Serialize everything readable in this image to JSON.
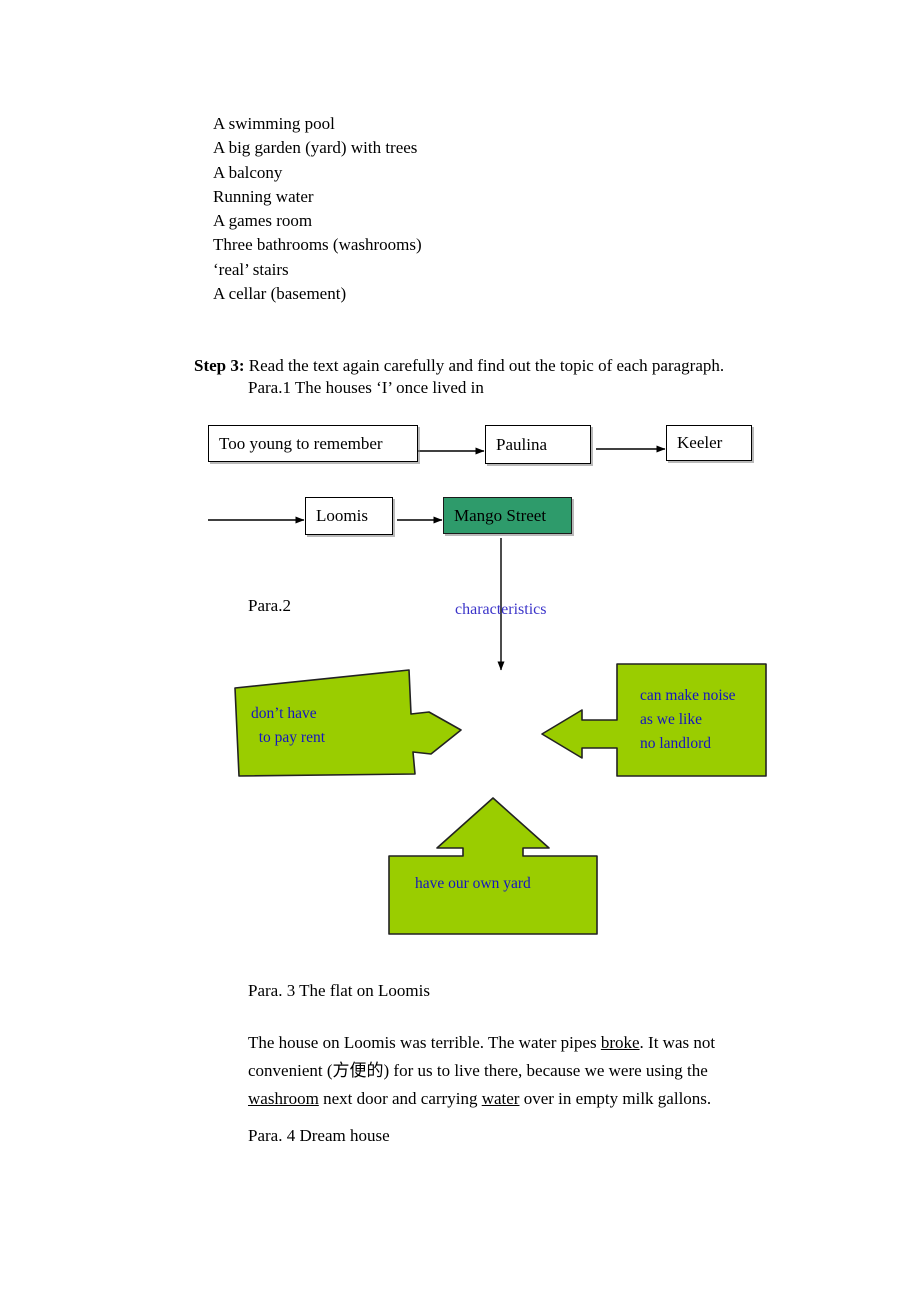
{
  "document": {
    "feature_list": [
      "A swimming pool",
      "A big garden (yard) with trees",
      "A balcony",
      "Running water",
      "A games room",
      "Three bathrooms (washrooms)",
      "‘real’ stairs",
      "A cellar (basement)"
    ],
    "step3": {
      "label": "Step 3:",
      "instruction": " Read the text again carefully and find out the topic of each paragraph.",
      "para1_line": "Para.1 The houses ‘I’ once lived in"
    },
    "flowchart": {
      "nodes": [
        {
          "id": "too-young",
          "label": "Too young to remember",
          "highlight": false
        },
        {
          "id": "paulina",
          "label": "Paulina",
          "highlight": false
        },
        {
          "id": "keeler",
          "label": "Keeler",
          "highlight": false
        },
        {
          "id": "loomis",
          "label": "Loomis",
          "highlight": false
        },
        {
          "id": "mango",
          "label": "Mango Street",
          "highlight": true
        }
      ],
      "highlight_fill": "#2E9B6B",
      "arrow_color": "#000000"
    },
    "para2": {
      "label": "Para.2",
      "characteristics_label": "characteristics",
      "characteristics_color": "#3b34c9",
      "callout_fill": "#9ACD00",
      "callout_text_color": "#1515c0",
      "callouts": {
        "left": {
          "lines": [
            "don’t have",
            "  to pay rent"
          ],
          "direction": "right-arrow"
        },
        "right": {
          "lines": [
            "can make noise",
            "as we like",
            "no landlord"
          ],
          "direction": "left-arrow"
        },
        "bottom": {
          "lines": [
            "have our own yard"
          ],
          "direction": "up-arrow"
        }
      }
    },
    "para3": {
      "title": "Para. 3 The flat on Loomis",
      "body_segments": [
        {
          "text": "The house on Loomis was terrible. The water pipes ",
          "underline": false
        },
        {
          "text": "broke",
          "underline": true
        },
        {
          "text": ". It was not convenient (方便的) for us to live there, because we were using the ",
          "underline": false
        },
        {
          "text": "washroom",
          "underline": true
        },
        {
          "text": " next door and carrying ",
          "underline": false
        },
        {
          "text": "water",
          "underline": true
        },
        {
          "text": " over in empty milk gallons.",
          "underline": false
        }
      ]
    },
    "para4": {
      "title": "Para. 4 Dream house"
    }
  }
}
